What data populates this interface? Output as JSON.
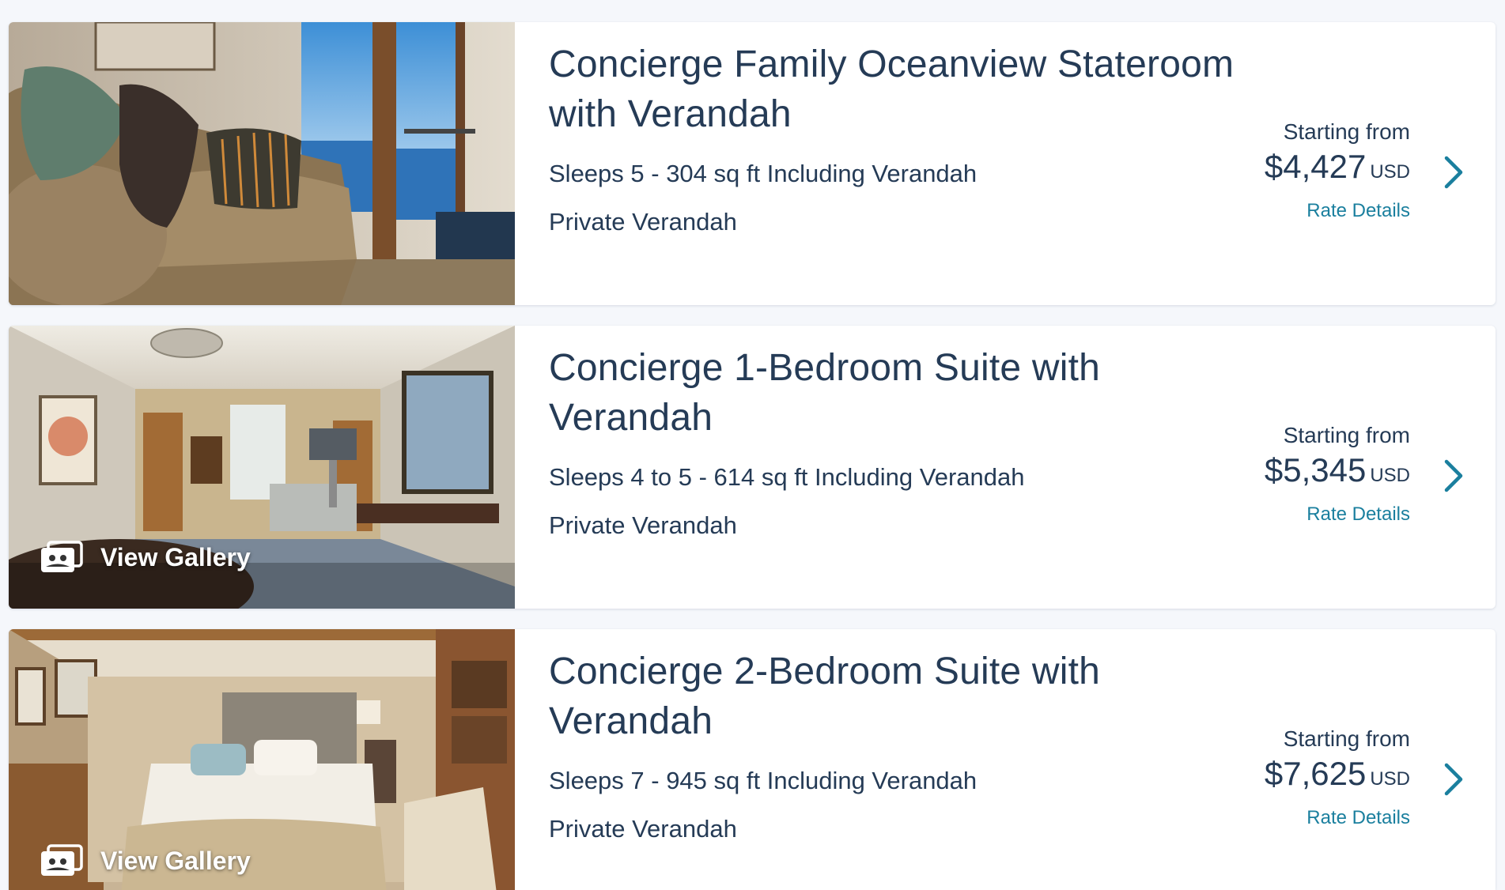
{
  "staterooms": [
    {
      "title": "Concierge Family Oceanview Stateroom with Verandah",
      "details": "Sleeps 5 - 304 sq ft Including Verandah",
      "feature": "Private Verandah",
      "price_label": "Starting from",
      "price": "$4,427",
      "currency": "USD",
      "rate_link": "Rate Details"
    },
    {
      "title": "Concierge 1-Bedroom Suite with Verandah",
      "details": "Sleeps 4 to 5 - 614 sq ft Including Verandah",
      "feature": "Private Verandah",
      "price_label": "Starting from",
      "price": "$5,345",
      "currency": "USD",
      "rate_link": "Rate Details",
      "gallery_label": "View Gallery"
    },
    {
      "title": "Concierge 2-Bedroom Suite with Verandah",
      "details": "Sleeps 7 - 945 sq ft Including Verandah",
      "feature": "Private Verandah",
      "price_label": "Starting from",
      "price": "$7,625",
      "currency": "USD",
      "rate_link": "Rate Details",
      "gallery_label": "View Gallery"
    }
  ],
  "icons": {
    "gallery": "photo-gallery-icon",
    "chevron": "chevron-right-icon"
  },
  "colors": {
    "text": "#253b56",
    "link": "#1a7f9e",
    "background": "#f5f7fb"
  }
}
